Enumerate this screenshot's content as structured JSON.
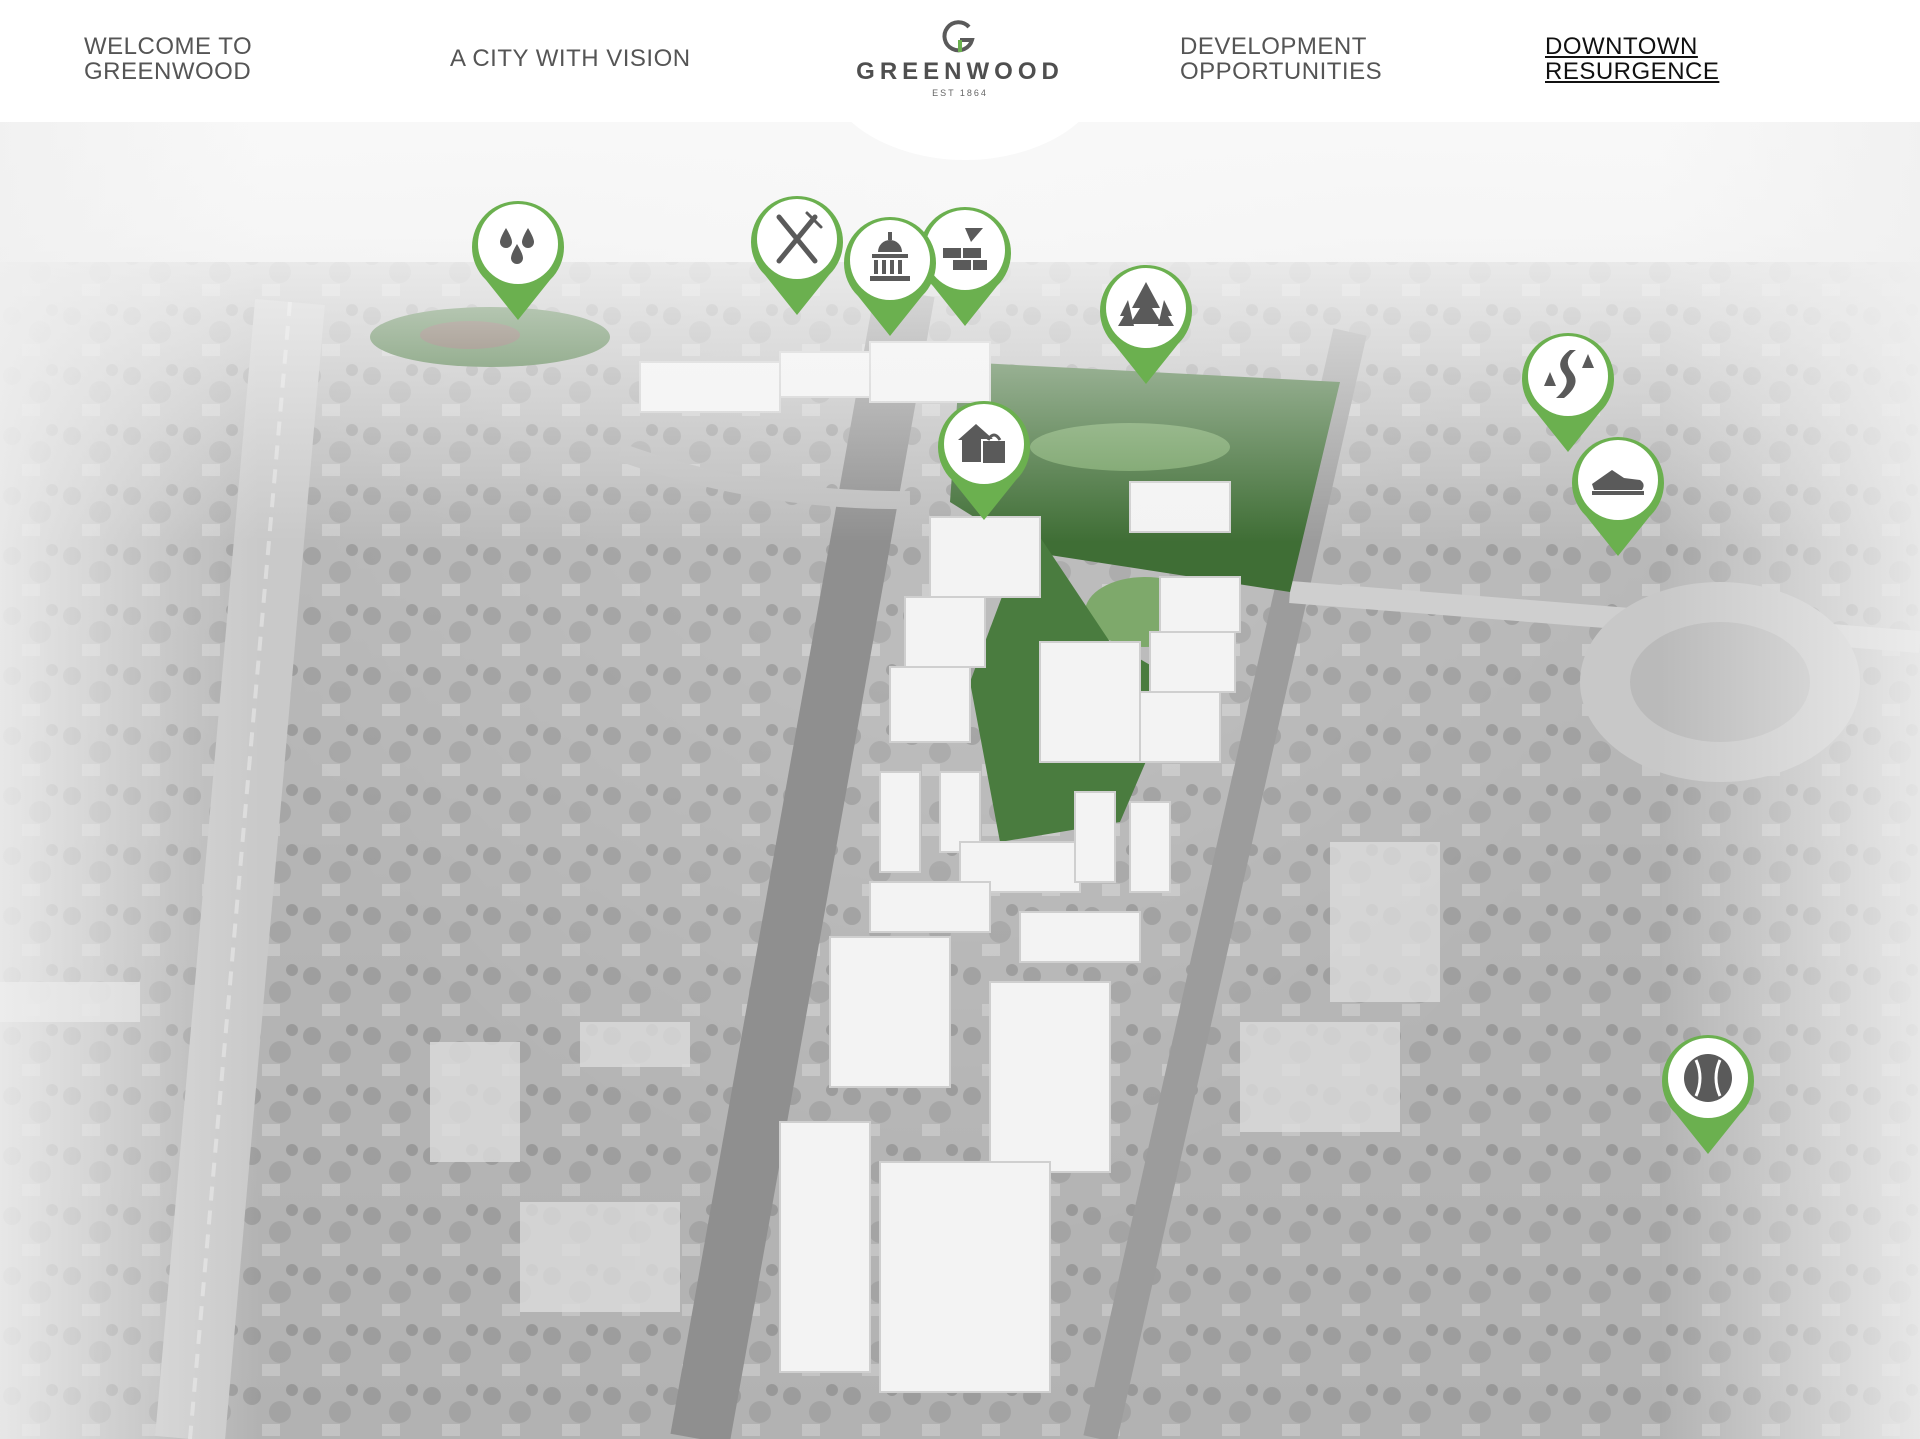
{
  "nav": {
    "welcome": {
      "line1": "WELCOME TO",
      "line2": "GREENWOOD"
    },
    "vision": {
      "label": "A CITY WITH VISION"
    },
    "development": {
      "line1": "DEVELOPMENT",
      "line2": "OPPORTUNITIES"
    },
    "downtown": {
      "line1": "DOWNTOWN",
      "line2": "RESURGENCE",
      "active": true
    }
  },
  "logo": {
    "mark": "G",
    "name": "GREENWOOD",
    "est": "EST 1864"
  },
  "colors": {
    "pin_green": "#6bb04f",
    "icon_gray": "#5a5a5a",
    "park_green": "#3f6e35",
    "building_white": "#f3f3f3",
    "nav_text": "#555555",
    "nav_active_text": "#111111"
  },
  "map_pins": [
    {
      "name": "water-features-pin",
      "icon": "water-drops-icon"
    },
    {
      "name": "dining-pin",
      "icon": "fork-knife-icon"
    },
    {
      "name": "city-hall-pin",
      "icon": "capitol-dome-icon"
    },
    {
      "name": "construction-pin",
      "icon": "brick-trowel-icon"
    },
    {
      "name": "park-pin",
      "icon": "pine-trees-icon"
    },
    {
      "name": "residential-retail-pin",
      "icon": "house-shopping-bag-icon"
    },
    {
      "name": "trail-pin",
      "icon": "winding-trail-icon"
    },
    {
      "name": "fitness-pin",
      "icon": "running-shoe-icon"
    },
    {
      "name": "baseball-pin",
      "icon": "baseball-icon"
    }
  ]
}
